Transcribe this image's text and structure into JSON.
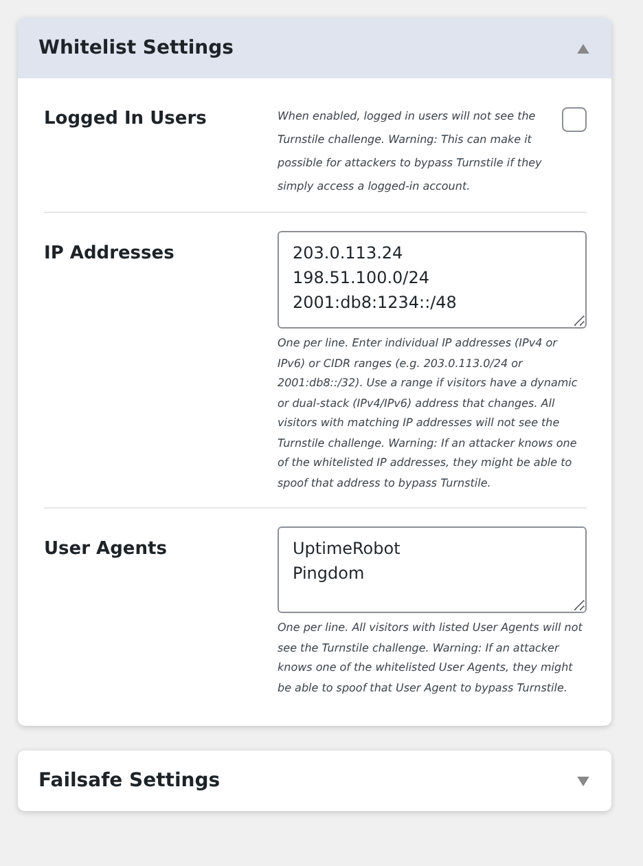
{
  "sections": [
    {
      "title": "Whitelist Settings",
      "expanded": true,
      "fields": [
        {
          "kind": "checkbox",
          "label": "Logged In Users",
          "checked": false,
          "description": "When enabled, logged in users will not see the Turnstile challenge. Warning: This can make it possible for attackers to bypass Turnstile if they simply access a logged-in account."
        },
        {
          "kind": "textarea",
          "label": "IP Addresses",
          "value": "203.0.113.24\n198.51.100.0/24\n2001:db8:1234::/48",
          "description": "One per line. Enter individual IP addresses (IPv4 or IPv6) or CIDR ranges (e.g. 203.0.113.0/24 or 2001:db8::/32). Use a range if visitors have a dynamic or dual-stack (IPv4/IPv6) address that changes. All visitors with matching IP addresses will not see the Turnstile challenge. Warning: If an attacker knows one of the whitelisted IP addresses, they might be able to spoof that address to bypass Turnstile."
        },
        {
          "kind": "textarea",
          "label": "User Agents",
          "value": "UptimeRobot\nPingdom",
          "description": "One per line. All visitors with listed User Agents will not see the Turnstile challenge. Warning: If an attacker knows one of the whitelisted User Agents, they might be able to spoof that User Agent to bypass Turnstile."
        }
      ]
    },
    {
      "title": "Failsafe Settings",
      "expanded": false
    }
  ]
}
